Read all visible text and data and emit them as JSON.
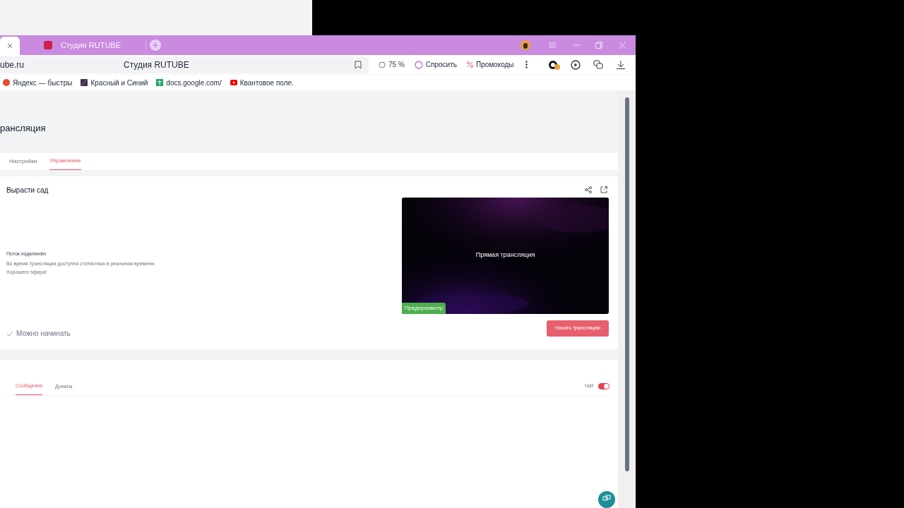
{
  "browser": {
    "tabs": [
      {
        "selected": true
      },
      {
        "title": "Студия RUTUBE",
        "selected": false
      }
    ],
    "address": "ube.ru",
    "page_title": "Студия RUTUBE",
    "zoom": "75 %",
    "ask": "Спросить",
    "promo": "Промокоды",
    "bookmarks": [
      {
        "label": "Яндекс — быстры"
      },
      {
        "label": "Красный и Синий"
      },
      {
        "label": "docs.google.com/"
      },
      {
        "label": "Квантовое поле."
      }
    ]
  },
  "page": {
    "title": "рансляция",
    "tabs": [
      {
        "label": "Настройки",
        "selected": false
      },
      {
        "label": "Управление",
        "selected": true
      }
    ],
    "stream": {
      "name": "Вырасти сад",
      "status": "Поток подключён",
      "info": "Во время трансляции доступна статистика в реальном времени.",
      "wish": "Хорошего эфира!",
      "ready": "Можно начинать",
      "preview_title": "Прямая трансляция",
      "preview_badge": "Предпросмотр",
      "start_button": "Начать трансляцию"
    },
    "chat": {
      "tabs": [
        {
          "label": "Сообщения",
          "selected": true
        },
        {
          "label": "Донаты",
          "selected": false
        }
      ],
      "toggle_label": "Чат",
      "on": true
    }
  }
}
